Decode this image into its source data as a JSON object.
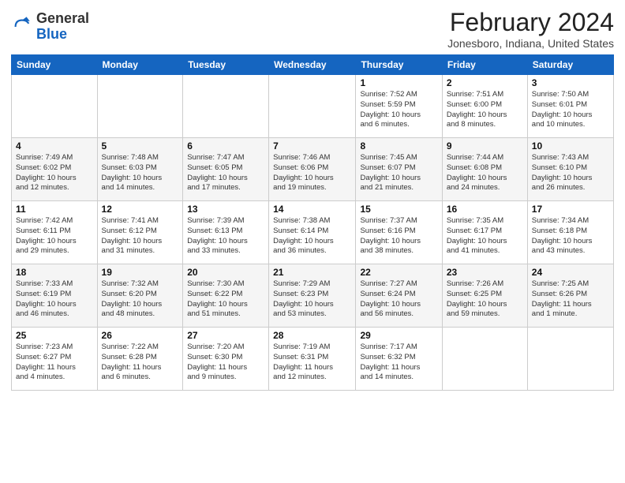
{
  "logo": {
    "general": "General",
    "blue": "Blue"
  },
  "title": "February 2024",
  "location": "Jonesboro, Indiana, United States",
  "days_of_week": [
    "Sunday",
    "Monday",
    "Tuesday",
    "Wednesday",
    "Thursday",
    "Friday",
    "Saturday"
  ],
  "weeks": [
    [
      {
        "day": "",
        "info": ""
      },
      {
        "day": "",
        "info": ""
      },
      {
        "day": "",
        "info": ""
      },
      {
        "day": "",
        "info": ""
      },
      {
        "day": "1",
        "info": "Sunrise: 7:52 AM\nSunset: 5:59 PM\nDaylight: 10 hours\nand 6 minutes."
      },
      {
        "day": "2",
        "info": "Sunrise: 7:51 AM\nSunset: 6:00 PM\nDaylight: 10 hours\nand 8 minutes."
      },
      {
        "day": "3",
        "info": "Sunrise: 7:50 AM\nSunset: 6:01 PM\nDaylight: 10 hours\nand 10 minutes."
      }
    ],
    [
      {
        "day": "4",
        "info": "Sunrise: 7:49 AM\nSunset: 6:02 PM\nDaylight: 10 hours\nand 12 minutes."
      },
      {
        "day": "5",
        "info": "Sunrise: 7:48 AM\nSunset: 6:03 PM\nDaylight: 10 hours\nand 14 minutes."
      },
      {
        "day": "6",
        "info": "Sunrise: 7:47 AM\nSunset: 6:05 PM\nDaylight: 10 hours\nand 17 minutes."
      },
      {
        "day": "7",
        "info": "Sunrise: 7:46 AM\nSunset: 6:06 PM\nDaylight: 10 hours\nand 19 minutes."
      },
      {
        "day": "8",
        "info": "Sunrise: 7:45 AM\nSunset: 6:07 PM\nDaylight: 10 hours\nand 21 minutes."
      },
      {
        "day": "9",
        "info": "Sunrise: 7:44 AM\nSunset: 6:08 PM\nDaylight: 10 hours\nand 24 minutes."
      },
      {
        "day": "10",
        "info": "Sunrise: 7:43 AM\nSunset: 6:10 PM\nDaylight: 10 hours\nand 26 minutes."
      }
    ],
    [
      {
        "day": "11",
        "info": "Sunrise: 7:42 AM\nSunset: 6:11 PM\nDaylight: 10 hours\nand 29 minutes."
      },
      {
        "day": "12",
        "info": "Sunrise: 7:41 AM\nSunset: 6:12 PM\nDaylight: 10 hours\nand 31 minutes."
      },
      {
        "day": "13",
        "info": "Sunrise: 7:39 AM\nSunset: 6:13 PM\nDaylight: 10 hours\nand 33 minutes."
      },
      {
        "day": "14",
        "info": "Sunrise: 7:38 AM\nSunset: 6:14 PM\nDaylight: 10 hours\nand 36 minutes."
      },
      {
        "day": "15",
        "info": "Sunrise: 7:37 AM\nSunset: 6:16 PM\nDaylight: 10 hours\nand 38 minutes."
      },
      {
        "day": "16",
        "info": "Sunrise: 7:35 AM\nSunset: 6:17 PM\nDaylight: 10 hours\nand 41 minutes."
      },
      {
        "day": "17",
        "info": "Sunrise: 7:34 AM\nSunset: 6:18 PM\nDaylight: 10 hours\nand 43 minutes."
      }
    ],
    [
      {
        "day": "18",
        "info": "Sunrise: 7:33 AM\nSunset: 6:19 PM\nDaylight: 10 hours\nand 46 minutes."
      },
      {
        "day": "19",
        "info": "Sunrise: 7:32 AM\nSunset: 6:20 PM\nDaylight: 10 hours\nand 48 minutes."
      },
      {
        "day": "20",
        "info": "Sunrise: 7:30 AM\nSunset: 6:22 PM\nDaylight: 10 hours\nand 51 minutes."
      },
      {
        "day": "21",
        "info": "Sunrise: 7:29 AM\nSunset: 6:23 PM\nDaylight: 10 hours\nand 53 minutes."
      },
      {
        "day": "22",
        "info": "Sunrise: 7:27 AM\nSunset: 6:24 PM\nDaylight: 10 hours\nand 56 minutes."
      },
      {
        "day": "23",
        "info": "Sunrise: 7:26 AM\nSunset: 6:25 PM\nDaylight: 10 hours\nand 59 minutes."
      },
      {
        "day": "24",
        "info": "Sunrise: 7:25 AM\nSunset: 6:26 PM\nDaylight: 11 hours\nand 1 minute."
      }
    ],
    [
      {
        "day": "25",
        "info": "Sunrise: 7:23 AM\nSunset: 6:27 PM\nDaylight: 11 hours\nand 4 minutes."
      },
      {
        "day": "26",
        "info": "Sunrise: 7:22 AM\nSunset: 6:28 PM\nDaylight: 11 hours\nand 6 minutes."
      },
      {
        "day": "27",
        "info": "Sunrise: 7:20 AM\nSunset: 6:30 PM\nDaylight: 11 hours\nand 9 minutes."
      },
      {
        "day": "28",
        "info": "Sunrise: 7:19 AM\nSunset: 6:31 PM\nDaylight: 11 hours\nand 12 minutes."
      },
      {
        "day": "29",
        "info": "Sunrise: 7:17 AM\nSunset: 6:32 PM\nDaylight: 11 hours\nand 14 minutes."
      },
      {
        "day": "",
        "info": ""
      },
      {
        "day": "",
        "info": ""
      }
    ]
  ]
}
